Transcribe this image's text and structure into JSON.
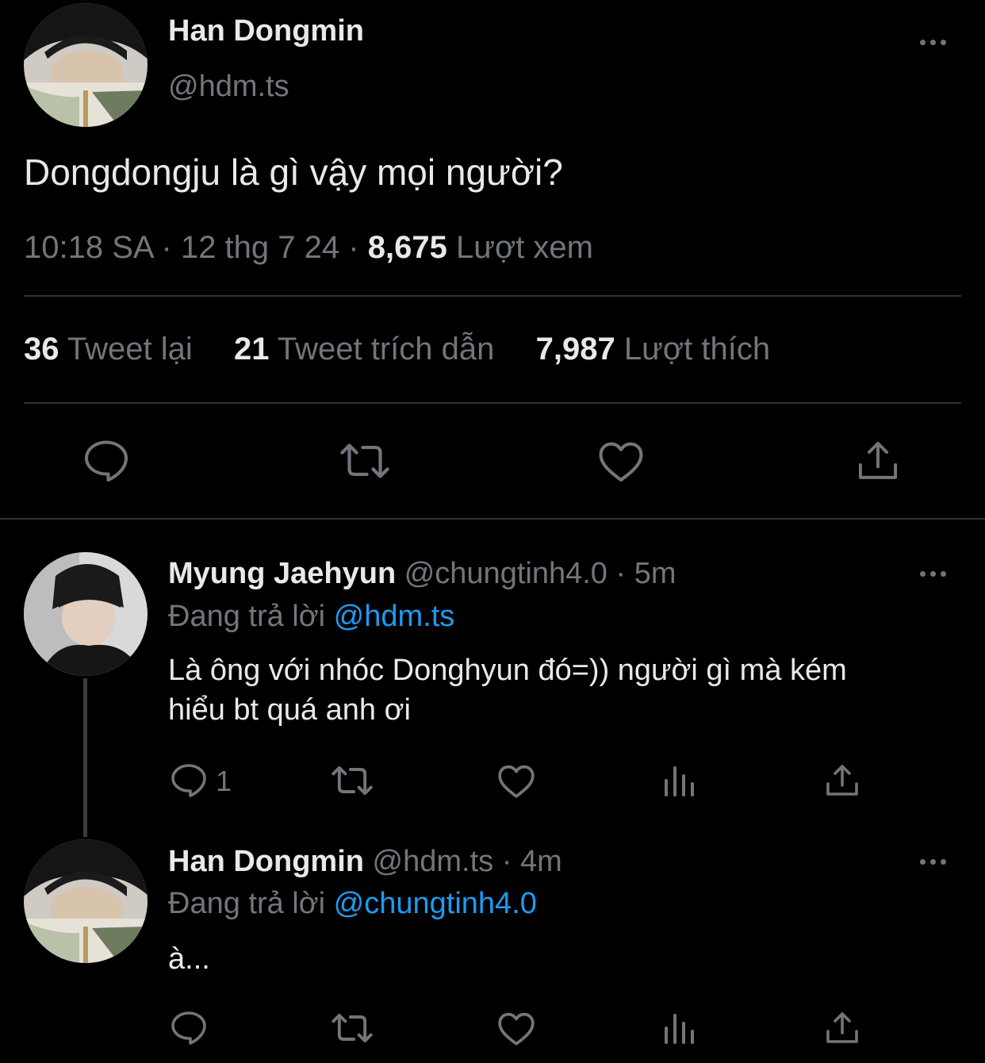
{
  "main_tweet": {
    "author_name": "Han Dongmin",
    "handle": "@hdm.ts",
    "text": "Dongdongju là gì vậy mọi người?",
    "time": "10:18 SA",
    "sep1": "·",
    "date": "12 thg 7 24",
    "sep2": "·",
    "views_count": "8,675",
    "views_label": "Lượt xem",
    "stats": {
      "retweets_count": "36",
      "retweets_label": "Tweet lại",
      "quotes_count": "21",
      "quotes_label": "Tweet trích dẫn",
      "likes_count": "7,987",
      "likes_label": "Lượt thích"
    }
  },
  "replies": [
    {
      "author_name": "Myung Jaehyun",
      "handle": "@chungtinh4.0",
      "sep": "·",
      "time": "5m",
      "replying_label": "Đang trả lời",
      "replying_to": "@hdm.ts",
      "text_line1": "Là ông với nhóc Donghyun đó=)) người gì mà kém",
      "text_line2": "hiểu bt quá anh ơi",
      "reply_count": "1"
    },
    {
      "author_name": "Han Dongmin",
      "handle": "@hdm.ts",
      "sep": "·",
      "time": "4m",
      "replying_label": "Đang trả lời",
      "replying_to": "@chungtinh4.0",
      "text_line1": "à...",
      "reply_count": ""
    }
  ],
  "icons": [
    "reply-icon",
    "retweet-icon",
    "like-icon",
    "share-icon",
    "analytics-icon",
    "more-icon"
  ],
  "colors": {
    "background": "#000000",
    "text": "#e7e9ea",
    "secondary": "#71767b",
    "link": "#1d9bf0",
    "divider": "#2f3336"
  }
}
